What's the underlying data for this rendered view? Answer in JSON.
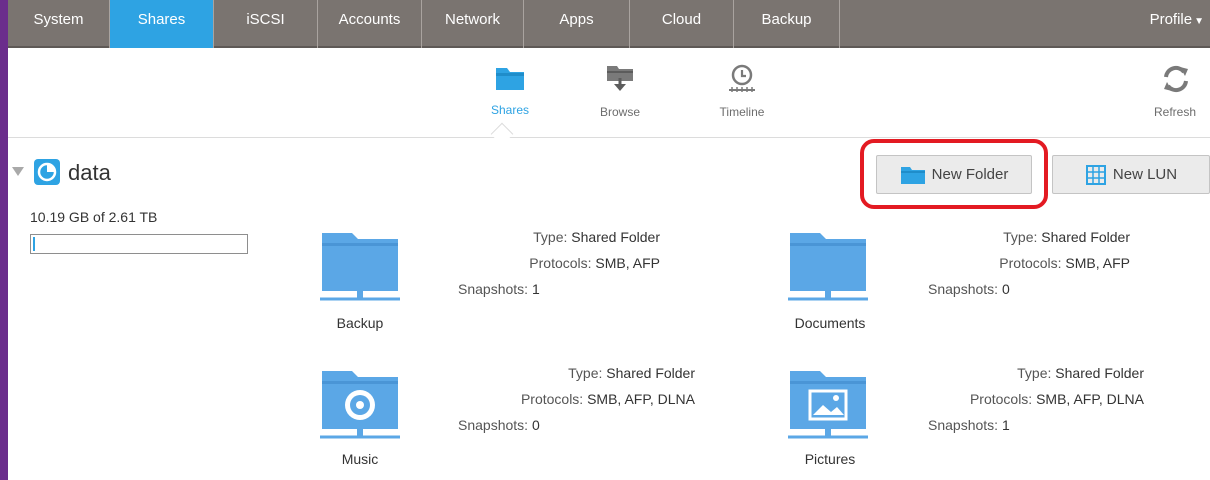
{
  "nav": {
    "tabs": [
      {
        "label": "System"
      },
      {
        "label": "Shares"
      },
      {
        "label": "iSCSI"
      },
      {
        "label": "Accounts"
      },
      {
        "label": "Network"
      },
      {
        "label": "Apps"
      },
      {
        "label": "Cloud"
      },
      {
        "label": "Backup"
      }
    ],
    "active_tab": "Shares",
    "profile_label": "Profile"
  },
  "subnav": {
    "shares_label": "Shares",
    "browse_label": "Browse",
    "timeline_label": "Timeline",
    "refresh_label": "Refresh"
  },
  "pool": {
    "name": "data",
    "usage_text": "10.19 GB of 2.61 TB",
    "usage_fraction": 0.004
  },
  "actions": {
    "new_folder_label": "New Folder",
    "new_lun_label": "New LUN"
  },
  "shares": [
    {
      "name": "Backup",
      "type_label": "Type:",
      "type_value": "Shared Folder",
      "protocols_label": "Protocols:",
      "protocols_value": "SMB, AFP",
      "snapshots_label": "Snapshots:",
      "snapshots_value": "1",
      "icon": "folder-icon"
    },
    {
      "name": "Documents",
      "type_label": "Type:",
      "type_value": "Shared Folder",
      "protocols_label": "Protocols:",
      "protocols_value": "SMB, AFP",
      "snapshots_label": "Snapshots:",
      "snapshots_value": "0",
      "icon": "folder-icon"
    },
    {
      "name": "Music",
      "type_label": "Type:",
      "type_value": "Shared Folder",
      "protocols_label": "Protocols:",
      "protocols_value": "SMB, AFP, DLNA",
      "snapshots_label": "Snapshots:",
      "snapshots_value": "0",
      "icon": "music-folder-icon"
    },
    {
      "name": "Pictures",
      "type_label": "Type:",
      "type_value": "Shared Folder",
      "protocols_label": "Protocols:",
      "protocols_value": "SMB, AFP, DLNA",
      "snapshots_label": "Snapshots:",
      "snapshots_value": "1",
      "icon": "pictures-folder-icon"
    }
  ],
  "colors": {
    "accent": "#2ea3e3",
    "nav_bg": "#7a7470",
    "highlight": "#e31a22"
  }
}
